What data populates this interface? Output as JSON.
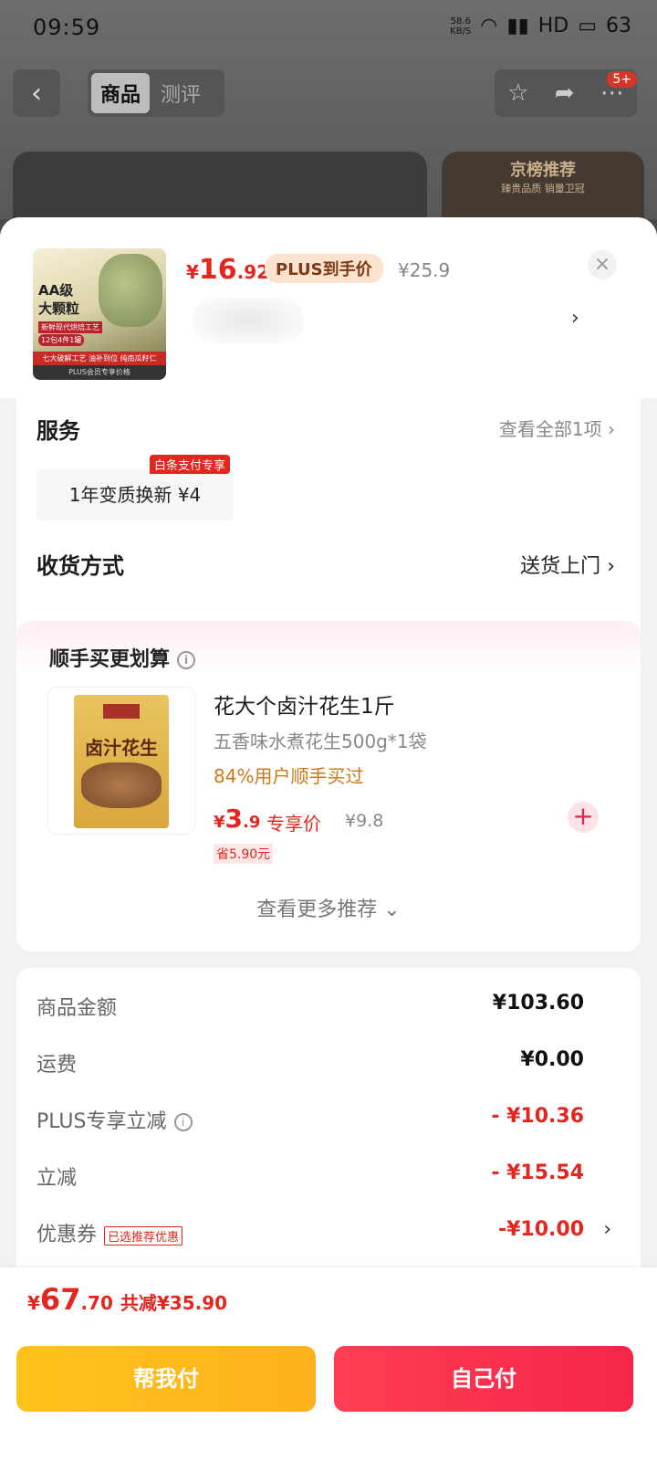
{
  "status": {
    "time": "09:59",
    "speed_top": "58.6",
    "speed_unit": "KB/S",
    "network": "HD",
    "battery": "63"
  },
  "nav": {
    "tabs": [
      "商品",
      "测评"
    ],
    "badge": "5+"
  },
  "banner": {
    "title": "京榜推荐",
    "subtitle": "臻贵品质 销量卫冠"
  },
  "product": {
    "thumb_line1": "AA级",
    "thumb_line2": "大颗粒",
    "thumb_tag1": "新鲜现代烘焙工艺",
    "thumb_tag2": "12包4件1罐",
    "thumb_strip": "七大破解工艺 油补到位 纯南瓜籽仁",
    "thumb_foot": "PLUS会员专享价格",
    "price_symbol": "¥",
    "price_int": "16",
    "price_dec": ".92",
    "plus_label": "PLUS到手价",
    "original_price": "¥25.9"
  },
  "services": {
    "title": "服务",
    "view_all": "查看全部1项",
    "chip_label": "1年变质换新 ¥4",
    "chip_badge": "白条支付专享",
    "delivery_title": "收货方式",
    "delivery_value": "送货上门"
  },
  "recommend": {
    "title": "顺手买更划算",
    "bag_label": "卤汁花生",
    "name": "花大个卤汁花生1斤",
    "desc": "五香味水煮花生500g*1袋",
    "bought": "84%用户顺手买过",
    "price_symbol": "¥",
    "price_int": "3",
    "price_dec": ".9",
    "price_tag": "专享价",
    "original": "¥9.8",
    "save": "省5.90元",
    "more": "查看更多推荐"
  },
  "summary": {
    "rows": [
      {
        "label": "商品金额",
        "value": "¥103.60"
      },
      {
        "label": "运费",
        "value": "¥0.00"
      },
      {
        "label": "PLUS专享立减",
        "value": "- ¥10.36"
      },
      {
        "label": "立减",
        "value": "- ¥15.54"
      },
      {
        "label": "优惠券",
        "badge": "已选推荐优惠",
        "value": "-¥10.00"
      }
    ]
  },
  "footer": {
    "total_symbol": "¥",
    "total_int": "67",
    "total_dec": ".70",
    "total_saved": "共减¥35.90",
    "help_pay": "帮我付",
    "self_pay": "自己付"
  },
  "colors": {
    "accent": "#e3261f",
    "help_button": "#ffc21a",
    "pay_button": "#f6254a"
  }
}
